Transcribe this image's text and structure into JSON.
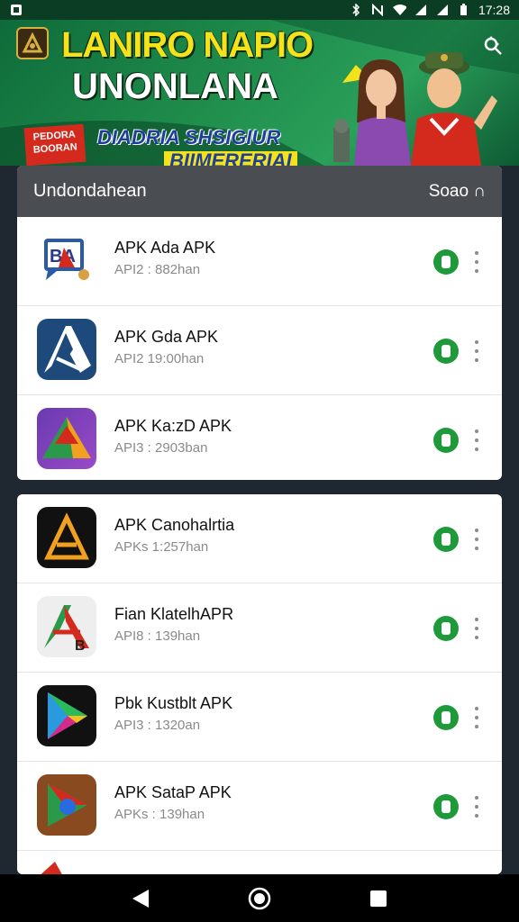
{
  "status_bar": {
    "time": "17:28",
    "icons": [
      "notification-icon",
      "bluetooth-icon",
      "nfc-icon",
      "wifi-icon",
      "signal-icon",
      "signal-icon",
      "battery-icon"
    ]
  },
  "banner": {
    "title_line1": "LANIRO NAPIO",
    "title_line2": "UNONLANA",
    "tag_text": "PEDORA BOORAN",
    "subtitle_line1": "DIADRIA SHSIGIUR",
    "subtitle_line2": "BIIMERERIAI",
    "search_icon": "search-icon"
  },
  "sections": [
    {
      "header_title": "Undondahean",
      "header_action": "Soao ∩",
      "apps": [
        {
          "name": "APK Ada APK",
          "meta": "API2 : 882han",
          "icon": "ba-chat-app-icon"
        },
        {
          "name": "APK Gda APK",
          "meta": "API2 19:00han",
          "icon": "blue-arrow-app-icon"
        },
        {
          "name": "APK Ka:zD APK",
          "meta": "API3 : 2903ban",
          "icon": "purple-triangle-app-icon"
        }
      ]
    },
    {
      "header_title": "",
      "header_action": "",
      "apps": [
        {
          "name": "APK Canohalrtia",
          "meta": "APKs 1:257han",
          "icon": "black-gold-a-app-icon"
        },
        {
          "name": "Fian KlatelhAPR",
          "meta": "API8 : 139han",
          "icon": "red-green-a-app-icon"
        },
        {
          "name": "Pbk Kustblt APK",
          "meta": "API3 : 1320an",
          "icon": "play-triangle-app-icon"
        },
        {
          "name": "APK SataP APK",
          "meta": "APKs : 139han",
          "icon": "brown-play-app-icon"
        }
      ]
    }
  ],
  "nav_bar": {
    "back_icon": "back-triangle-icon",
    "home_icon": "home-circle-icon",
    "recents_icon": "recents-square-icon"
  },
  "colors": {
    "banner_green": "#1e8a4a",
    "title_yellow": "#f4e21a",
    "download_green": "#1e9a3a",
    "header_gray": "#4a4e52"
  }
}
